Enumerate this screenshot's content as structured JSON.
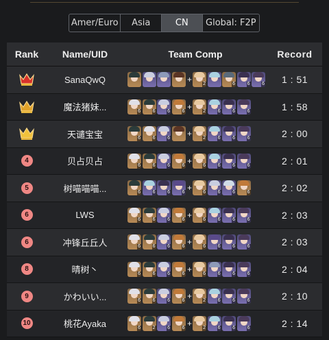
{
  "region_tabs": [
    {
      "label": "Amer/Euro",
      "active": false
    },
    {
      "label": "Asia",
      "active": false
    },
    {
      "label": "CN",
      "active": true
    },
    {
      "label": "Global: F2P",
      "active": false
    }
  ],
  "table": {
    "headers": {
      "rank": "Rank",
      "name": "Name/UID",
      "team": "Team Comp",
      "record": "Record"
    },
    "rows": [
      {
        "rank": "1",
        "rank_style": "crown-red",
        "name": "SanaQwQ",
        "record": "1 : 51",
        "team": [
          [
            "5",
            "",
            "#2b3b3a"
          ],
          [
            "4",
            "",
            "#c9cde0"
          ],
          [
            "4",
            "",
            "#8d9ab8"
          ],
          [
            "5",
            "",
            "#5a3424"
          ],
          [
            "5",
            "2",
            "#e8c9a0"
          ],
          [
            "4",
            "",
            "#a9d1e0"
          ],
          [
            "5",
            "6",
            "#5a6a7a"
          ],
          [
            "4",
            "6",
            "#3a3050"
          ],
          [
            "4",
            "6",
            "#4a3a5a"
          ]
        ]
      },
      {
        "rank": "2",
        "rank_style": "crown-gold",
        "name": "魔法猪妹...",
        "record": "1 : 58",
        "team": [
          [
            "5",
            "6",
            "#e0e0e8"
          ],
          [
            "5",
            "6",
            "#2b3b3a"
          ],
          [
            "4",
            "6",
            "#c9cde0"
          ],
          [
            "5",
            "6",
            "#c07a3a"
          ],
          [
            "5",
            "2",
            "#e8c9a0"
          ],
          [
            "4",
            "6",
            "#a9d1e0"
          ],
          [
            "4",
            "6",
            "#3a3050"
          ],
          [
            "4",
            "6",
            "#4a3a5a"
          ]
        ]
      },
      {
        "rank": "3",
        "rank_style": "crown-bright",
        "name": "天谴宝宝",
        "record": "2 : 00",
        "team": [
          [
            "5",
            "6",
            "#2b3b3a"
          ],
          [
            "5",
            "6",
            "#e0e0e8"
          ],
          [
            "4",
            "6",
            "#c9cde0"
          ],
          [
            "5",
            "",
            "#5a3424"
          ],
          [
            "5",
            "2",
            "#e8c9a0"
          ],
          [
            "4",
            "6",
            "#a9d1e0"
          ],
          [
            "4",
            "6",
            "#3a3050"
          ],
          [
            "4",
            "6",
            "#4a3a5a"
          ]
        ]
      },
      {
        "rank": "4",
        "rank_style": "badge",
        "name": "贝占贝占",
        "record": "2 : 01",
        "team": [
          [
            "5",
            "6",
            "#e0e0e8"
          ],
          [
            "5",
            "6",
            "#2b3b3a"
          ],
          [
            "4",
            "6",
            "#c9cde0"
          ],
          [
            "5",
            "6",
            "#c07a3a"
          ],
          [
            "5",
            "6",
            "#e8c9a0"
          ],
          [
            "4",
            "6",
            "#a9d1e0"
          ],
          [
            "4",
            "6",
            "#3a3050"
          ],
          [
            "4",
            "6",
            "#4a3a5a"
          ]
        ]
      },
      {
        "rank": "5",
        "rank_style": "badge",
        "name": "树喵喵喵...",
        "record": "2 : 02",
        "team": [
          [
            "5",
            "6",
            "#2b3b3a"
          ],
          [
            "4",
            "6",
            "#a9d1e0"
          ],
          [
            "4",
            "6",
            "#3a3050"
          ],
          [
            "4",
            "6",
            "#5a4a8a"
          ],
          [
            "5",
            "6",
            "#e8c9a0"
          ],
          [
            "4",
            "6",
            "#c9cde0"
          ],
          [
            "4",
            "6",
            "#d0dce8"
          ],
          [
            "5",
            "6",
            "#c07a3a"
          ]
        ]
      },
      {
        "rank": "6",
        "rank_style": "badge",
        "name": "LWS",
        "record": "2 : 03",
        "team": [
          [
            "5",
            "6",
            "#e0e0e8"
          ],
          [
            "5",
            "6",
            "#2b3b3a"
          ],
          [
            "4",
            "6",
            "#c9cde0"
          ],
          [
            "5",
            "6",
            "#c07a3a"
          ],
          [
            "5",
            "6",
            "#e8c9a0"
          ],
          [
            "4",
            "6",
            "#a9d1e0"
          ],
          [
            "4",
            "6",
            "#3a3050"
          ],
          [
            "4",
            "6",
            "#4a3a5a"
          ]
        ]
      },
      {
        "rank": "6",
        "rank_style": "badge",
        "name": "冲锋丘丘人",
        "record": "2 : 03",
        "team": [
          [
            "5",
            "6",
            "#e0e0e8"
          ],
          [
            "5",
            "6",
            "#2b3b3a"
          ],
          [
            "4",
            "6",
            "#c9cde0"
          ],
          [
            "5",
            "6",
            "#c07a3a"
          ],
          [
            "5",
            "6",
            "#e8c9a0"
          ],
          [
            "4",
            "6",
            "#5a4a8a"
          ],
          [
            "4",
            "6",
            "#3a3050"
          ],
          [
            "4",
            "6",
            "#4a3a5a"
          ]
        ]
      },
      {
        "rank": "8",
        "rank_style": "badge",
        "name": "晴树丶",
        "record": "2 : 04",
        "team": [
          [
            "5",
            "6",
            "#e0e0e8"
          ],
          [
            "5",
            "6",
            "#2b3b3a"
          ],
          [
            "4",
            "6",
            "#c9cde0"
          ],
          [
            "5",
            "6",
            "#c07a3a"
          ],
          [
            "5",
            "6",
            "#e8c9a0"
          ],
          [
            "4",
            "6",
            "#8d9ab8"
          ],
          [
            "4",
            "6",
            "#3a3050"
          ],
          [
            "4",
            "6",
            "#4a3a5a"
          ]
        ]
      },
      {
        "rank": "9",
        "rank_style": "badge",
        "name": "かわいい...",
        "record": "2 : 10",
        "team": [
          [
            "5",
            "6",
            "#e0e0e8"
          ],
          [
            "5",
            "6",
            "#2b3b3a"
          ],
          [
            "4",
            "6",
            "#c9cde0"
          ],
          [
            "5",
            "6",
            "#c07a3a"
          ],
          [
            "5",
            "2",
            "#e8c9a0"
          ],
          [
            "4",
            "6",
            "#a9d1e0"
          ],
          [
            "4",
            "6",
            "#3a3050"
          ],
          [
            "4",
            "6",
            "#4a3a5a"
          ]
        ]
      },
      {
        "rank": "10",
        "rank_style": "badge",
        "name": "桃花Ayaka",
        "record": "2 : 14",
        "team": [
          [
            "5",
            "6",
            "#e0e0e8"
          ],
          [
            "5",
            "2",
            "#2b3b3a"
          ],
          [
            "4",
            "6",
            "#c9cde0"
          ],
          [
            "5",
            "6",
            "#c07a3a"
          ],
          [
            "5",
            "2",
            "#e8c9a0"
          ],
          [
            "4",
            "6",
            "#a9d1e0"
          ],
          [
            "4",
            "6",
            "#3a3050"
          ],
          [
            "4",
            "6",
            "#4a3a5a"
          ]
        ]
      }
    ]
  },
  "colors": {
    "badge": "#ef8784",
    "crown_red": "#d8322b",
    "crown_gold": "#e0a22a",
    "crown_bright": "#f1c23b",
    "five_star_bg": "#b78a56",
    "four_star_bg": "#7a6fb0"
  }
}
